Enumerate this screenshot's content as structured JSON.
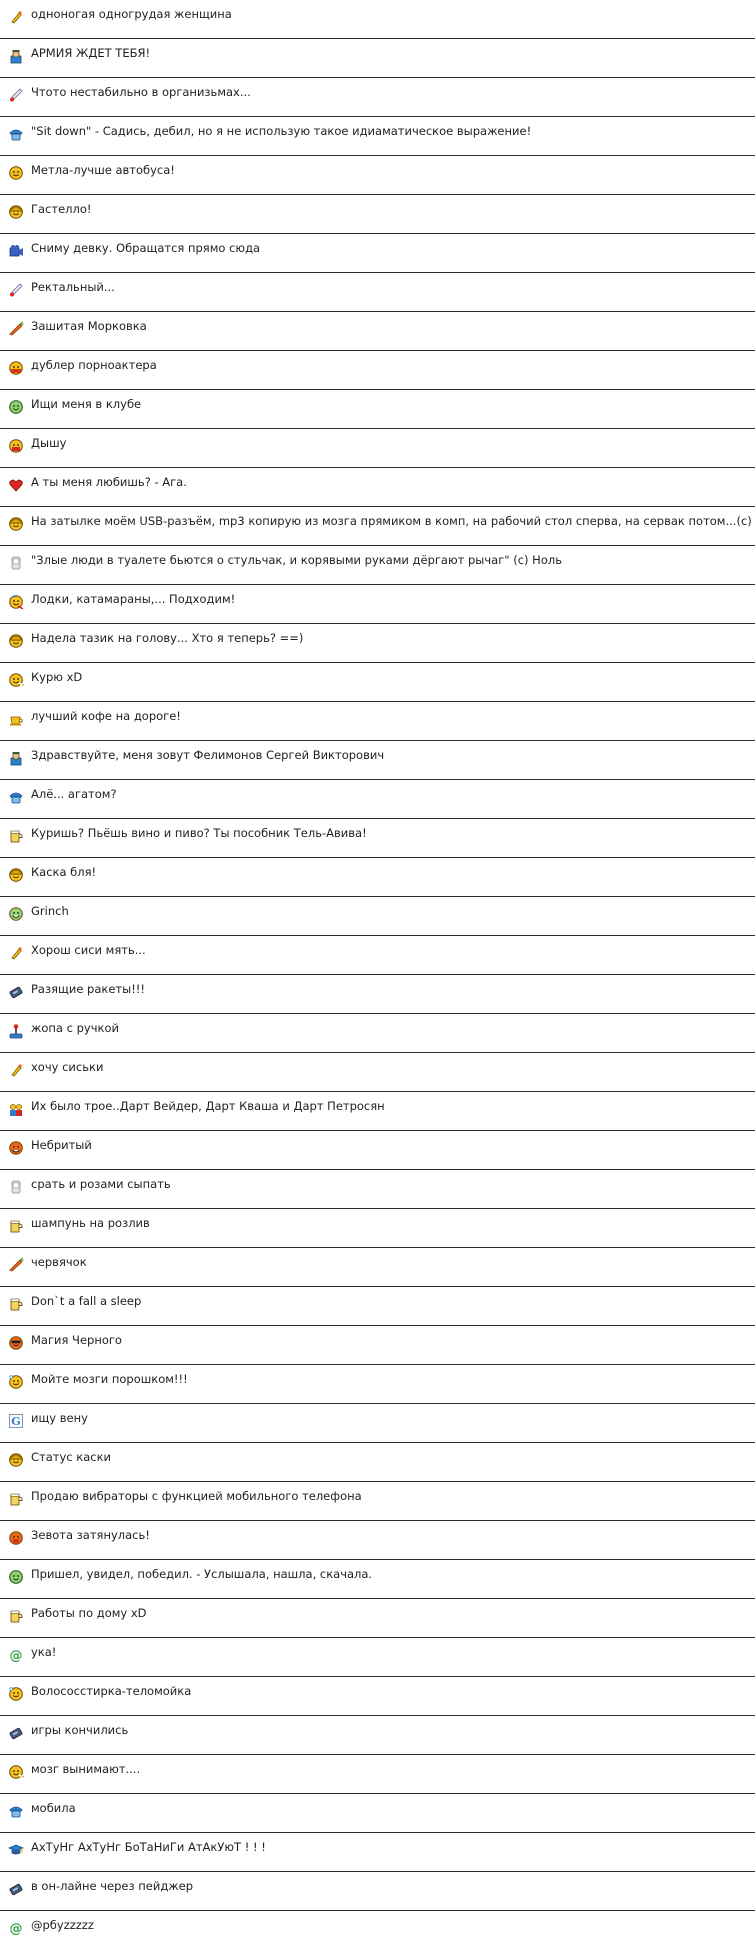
{
  "statuses": [
    {
      "icon": "leg-icon",
      "text": "одноногая одногрудая женщина"
    },
    {
      "icon": "soldier-icon",
      "text": "АРМИЯ ЖДЕТ ТЕБЯ!"
    },
    {
      "icon": "thermometer-icon",
      "text": "Чтото нестабильно в организьмах..."
    },
    {
      "icon": "phone-icon",
      "text": "\"Sit down\" - Садись, дебил, но я не использую такое идиаматическое выражение!"
    },
    {
      "icon": "smiley-icon",
      "text": "Метла-лучше автобуса!"
    },
    {
      "icon": "helmet-smiley-icon",
      "text": "Гастелло!"
    },
    {
      "icon": "camera-icon",
      "text": "Сниму девку. Обращатся прямо сюда"
    },
    {
      "icon": "thermometer-icon",
      "text": "Ректальный..."
    },
    {
      "icon": "carrot-icon",
      "text": "Зашитая Морковка"
    },
    {
      "icon": "double-smiley-icon",
      "text": "дублер порноактера"
    },
    {
      "icon": "search-smiley-icon",
      "text": "Ищи меня в клубе"
    },
    {
      "icon": "breathing-smiley-icon",
      "text": "Дышу"
    },
    {
      "icon": "heart-icon",
      "text": "А ты меня любишь? - Ага."
    },
    {
      "icon": "helmet-smiley-icon",
      "text": "На затылке моём USB-разъём, mp3 копирую из мозга прямиком в комп, на рабочий стол сперва, на сервак потом...(c)"
    },
    {
      "icon": "toilet-icon",
      "text": "\"Злые люди в туалете бьются о стульчак, и корявыми руками дёргают рычаг\" (c) Ноль"
    },
    {
      "icon": "surf-smiley-icon",
      "text": "Лодки, катамараны,... Подходим!"
    },
    {
      "icon": "helmet-smiley-icon",
      "text": "Надела тазик на голову... Хто я теперь? ==)"
    },
    {
      "icon": "smoking-smiley-icon",
      "text": "Курю xD"
    },
    {
      "icon": "coffee-icon",
      "text": "лучший кофе на дороге!"
    },
    {
      "icon": "soldier-icon",
      "text": "Здравствуйте, меня зовут Фелимонов Сергей Викторович"
    },
    {
      "icon": "phone-icon",
      "text": "Алё... агатом?"
    },
    {
      "icon": "beer-icon",
      "text": "Куришь? Пьёшь вино и пиво? Ты пособник Тель-Авива!"
    },
    {
      "icon": "helmet-smiley-icon",
      "text": "Каска бля!"
    },
    {
      "icon": "grinch-smiley-icon",
      "text": "Grinch"
    },
    {
      "icon": "leg-icon",
      "text": "Хорош сиси мять..."
    },
    {
      "icon": "pager-icon",
      "text": "Разящие ракеты!!!"
    },
    {
      "icon": "joystick-icon",
      "text": "жопа с ручкой"
    },
    {
      "icon": "leg-icon",
      "text": "хочу сиськи"
    },
    {
      "icon": "group-icon",
      "text": "Их было трое..Дарт Вейдер, Дарт Кваша и Дарт Петросян"
    },
    {
      "icon": "unshaven-smiley-icon",
      "text": "Небритый"
    },
    {
      "icon": "toilet-icon",
      "text": "срать и розами сыпать"
    },
    {
      "icon": "beer-icon",
      "text": "шампунь на розлив"
    },
    {
      "icon": "carrot-icon",
      "text": "червячок"
    },
    {
      "icon": "beer-icon",
      "text": "Don`t a fall a sleep"
    },
    {
      "icon": "cool-smiley-icon",
      "text": "Магия Черного"
    },
    {
      "icon": "washing-smiley-icon",
      "text": "Мойте мозги порошком!!!"
    },
    {
      "icon": "g-letter-icon",
      "text": "ищу вену"
    },
    {
      "icon": "helmet-smiley-icon",
      "text": "Статус каски"
    },
    {
      "icon": "beer-icon",
      "text": "Продаю вибраторы с функцией мобильного телефона"
    },
    {
      "icon": "yawn-smiley-icon",
      "text": "Зевота затянулась!"
    },
    {
      "icon": "search-smiley-icon",
      "text": "Пришел, увидел, победил. - Услышала, нашла, скачала."
    },
    {
      "icon": "beer-icon",
      "text": "Работы по дому xD"
    },
    {
      "icon": "at-sign-icon",
      "text": "ука!"
    },
    {
      "icon": "washing-smiley-icon",
      "text": "Волососстирка-теломойка"
    },
    {
      "icon": "pager-icon",
      "text": "игры кончились"
    },
    {
      "icon": "smoking-smiley-icon",
      "text": "мозг вынимают...."
    },
    {
      "icon": "phone-icon",
      "text": "мобила"
    },
    {
      "icon": "graduation-cap-icon",
      "text": "АхТуНг АхТуНг БоТаНиГи АтАкУюТ ! ! !"
    },
    {
      "icon": "pager-icon",
      "text": "в он-лайне через пейджер"
    },
    {
      "icon": "at-sign-icon",
      "text": "@pбyzzzzz"
    }
  ],
  "colors": {
    "yellow": "#f6c21a",
    "blue": "#2f7fd1",
    "red": "#d7281f",
    "orange": "#e8671c",
    "green": "#39a54a",
    "gray": "#a9a9a9",
    "border": "#2b2b2b"
  }
}
